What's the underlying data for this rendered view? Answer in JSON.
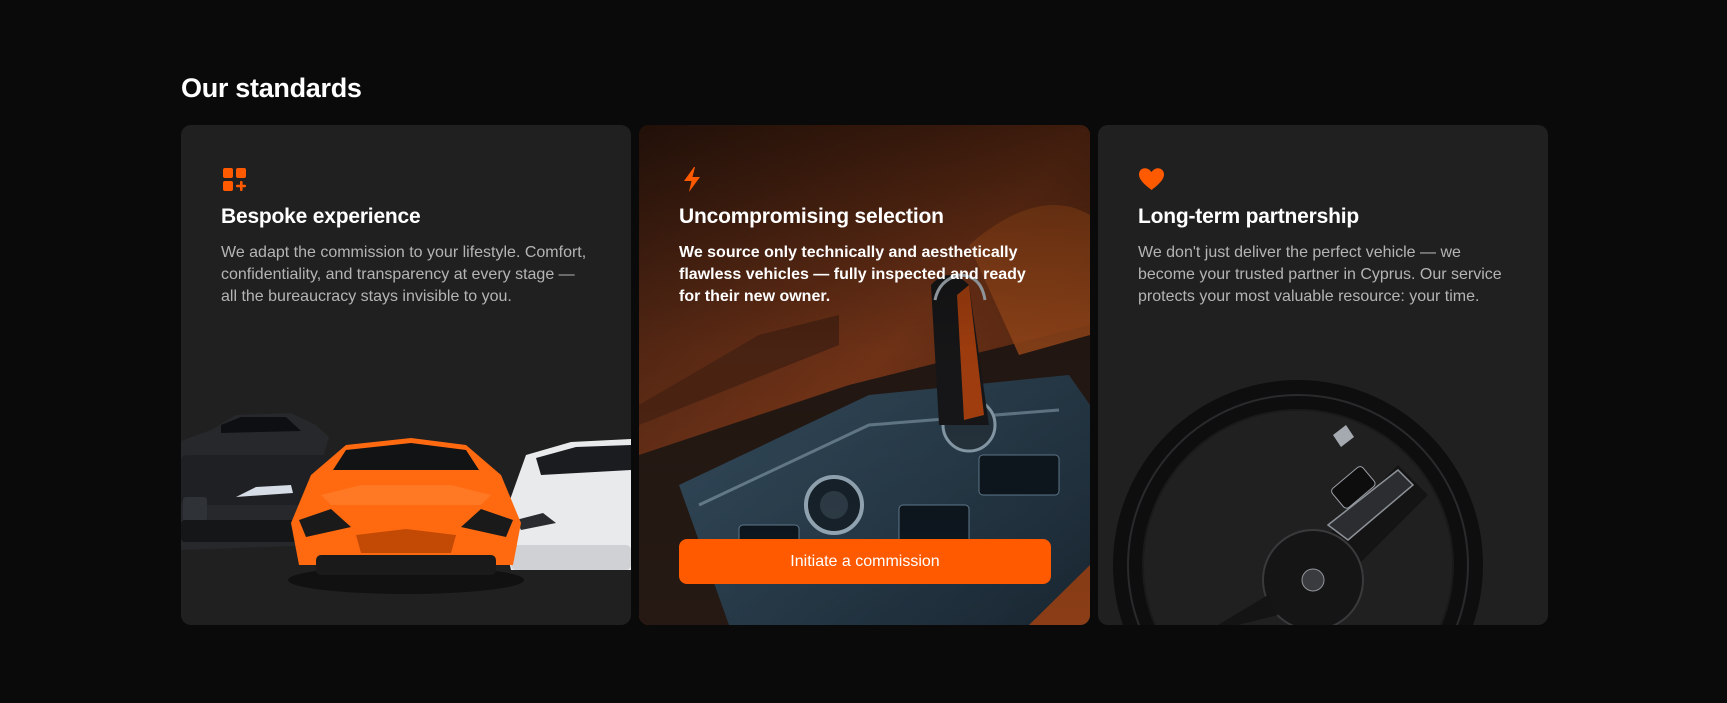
{
  "section": {
    "title": "Our standards"
  },
  "cards": [
    {
      "icon": "grid-plus-icon",
      "title": "Bespoke experience",
      "text": "We adapt the commission to your lifestyle. Comfort, confidentiality, and transparency at every stage — all the bureaucracy stays invisible to you.",
      "image": "cars-lineup-illustration"
    },
    {
      "icon": "lightning-icon",
      "title": "Uncompromising selection",
      "text": "We source only technically and aesthetically flawless vehicles — fully inspected and ready for their new owner.",
      "image": "car-interior-gear-shifter-photo",
      "cta_label": "Initiate a commission"
    },
    {
      "icon": "heart-icon",
      "title": "Long-term partnership",
      "text": "We don't just deliver the perfect vehicle — we become your trusted partner in Cyprus. Our service protects your most valuable resource: your time.",
      "image": "steering-wheel-photo"
    }
  ],
  "colors": {
    "accent": "#ff5a00",
    "background": "#0a0a0a",
    "card": "#202020",
    "muted_text": "#b4b4b4"
  }
}
